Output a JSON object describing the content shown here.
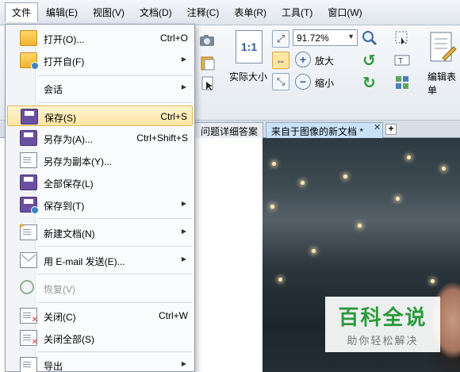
{
  "menubar": {
    "items": [
      "文件",
      "编辑(E)",
      "视图(V)",
      "文档(D)",
      "注释(C)",
      "表单(R)",
      "工具(T)",
      "窗口(W)"
    ]
  },
  "toolbar": {
    "zoom_value": "91.72%",
    "actual_size_label": "实际大小",
    "actual_size_icon_text": "1:1",
    "zoom_in_label": "放大",
    "zoom_out_label": "缩小",
    "edit_form_label": "编辑表单"
  },
  "tabs": [
    {
      "label": "问题详细答案"
    },
    {
      "label": "来自于图像的新文档 *"
    }
  ],
  "file_menu": {
    "items": [
      {
        "label": "打开(O)...",
        "shortcut": "Ctrl+O",
        "icon": "folder-open-icon"
      },
      {
        "label": "打开自(F)",
        "submenu": "▶",
        "icon": "folder-globe-icon"
      },
      {
        "label": "会话",
        "submenu": "▶",
        "icon": "session-icon"
      },
      {
        "label": "保存(S)",
        "shortcut": "Ctrl+S",
        "icon": "save-icon",
        "highlighted": true
      },
      {
        "label": "另存为(A)...",
        "shortcut": "Ctrl+Shift+S",
        "icon": "save-as-icon"
      },
      {
        "label": "另存为副本(Y)...",
        "icon": "save-copy-icon"
      },
      {
        "label": "全部保存(L)",
        "icon": "save-all-icon"
      },
      {
        "label": "保存到(T)",
        "submenu": "▶",
        "icon": "save-to-icon"
      },
      {
        "label": "新建文档(N)",
        "submenu": "▶",
        "icon": "new-document-icon"
      },
      {
        "label": "用 E-mail 发送(E)...",
        "submenu": "▶",
        "icon": "email-icon"
      },
      {
        "label": "恢复(V)",
        "icon": "restore-icon",
        "disabled": true
      },
      {
        "label": "关闭(C)",
        "shortcut": "Ctrl+W",
        "icon": "close-document-icon"
      },
      {
        "label": "关闭全部(S)",
        "icon": "close-all-icon"
      },
      {
        "label": "导出",
        "submenu": "▶",
        "icon": "export-icon"
      }
    ]
  },
  "watermark": {
    "title": "百科全说",
    "subtitle": "助你轻松解决"
  },
  "colors": {
    "menu_highlight": "#fde6a2",
    "active_tab": "#c9e2f7",
    "watermark_green": "#2a9a3a"
  }
}
